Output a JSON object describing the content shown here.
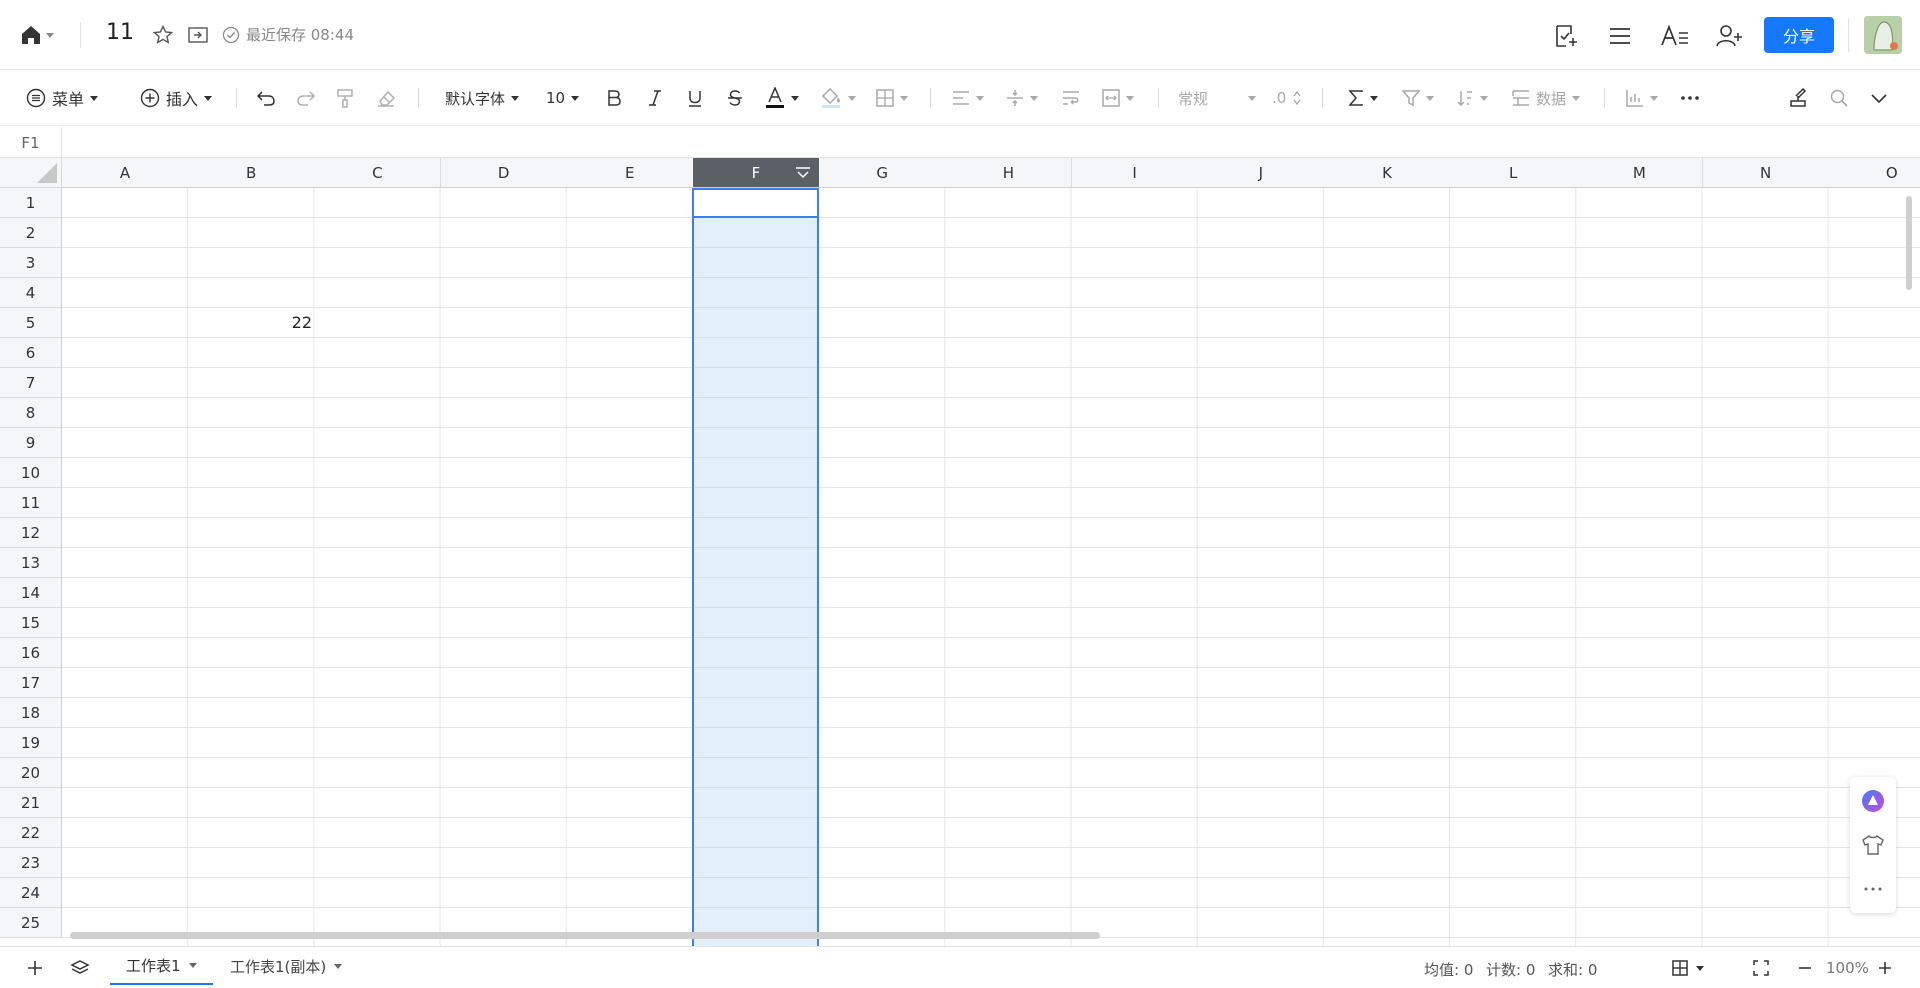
{
  "header": {
    "doc_title": "11",
    "save_status": "最近保存 08:44",
    "share_label": "分享"
  },
  "toolbar": {
    "menu_label": "菜单",
    "insert_label": "插入",
    "font_name": "默认字体",
    "font_size": "10",
    "number_format": "常规",
    "decimal_label": ".0",
    "data_label": "数据"
  },
  "namebox": {
    "cell_ref": "F1"
  },
  "columns": [
    "A",
    "B",
    "C",
    "D",
    "E",
    "F",
    "G",
    "H",
    "I",
    "J",
    "K",
    "L",
    "M",
    "N",
    "O"
  ],
  "selected_column": "F",
  "rows": [
    "1",
    "2",
    "3",
    "4",
    "5",
    "6",
    "7",
    "8",
    "9",
    "10",
    "11",
    "12",
    "13",
    "14",
    "15",
    "16",
    "17",
    "18",
    "19",
    "20",
    "21",
    "22",
    "23",
    "24",
    "25"
  ],
  "cells": {
    "B5": "22"
  },
  "sheets": [
    {
      "label": "工作表1",
      "active": true
    },
    {
      "label": "工作表1(副本)",
      "active": false
    }
  ],
  "status": {
    "avg": "均值: 0",
    "count": "计数: 0",
    "sum": "求和: 0",
    "zoom": "100%"
  },
  "colors": {
    "accent": "#1677ff",
    "selection_border": "#3b7ff0",
    "selection_fill": "#e3effb",
    "header_selected": "#5a6066"
  }
}
